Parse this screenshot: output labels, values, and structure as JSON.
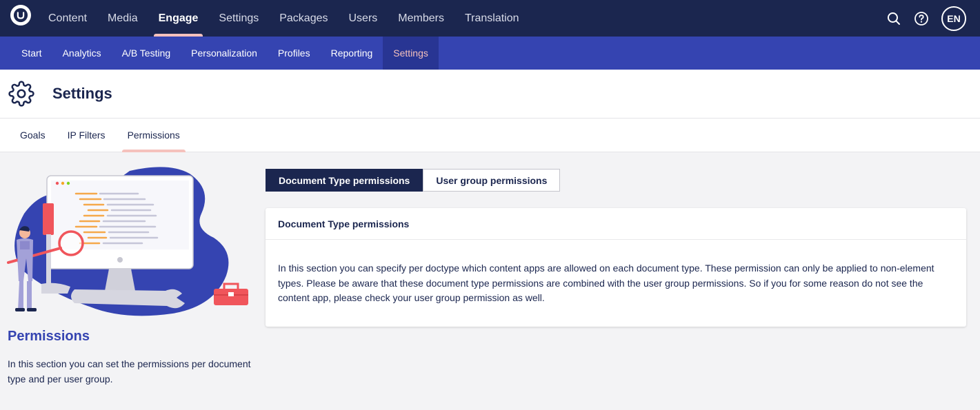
{
  "top_nav": {
    "items": [
      {
        "label": "Content",
        "active": false
      },
      {
        "label": "Media",
        "active": false
      },
      {
        "label": "Engage",
        "active": true
      },
      {
        "label": "Settings",
        "active": false
      },
      {
        "label": "Packages",
        "active": false
      },
      {
        "label": "Users",
        "active": false
      },
      {
        "label": "Members",
        "active": false
      },
      {
        "label": "Translation",
        "active": false
      }
    ],
    "avatar_initials": "EN",
    "icons": [
      "umbraco-logo-icon",
      "search-icon",
      "help-icon"
    ]
  },
  "sub_nav": {
    "items": [
      {
        "label": "Start",
        "active": false
      },
      {
        "label": "Analytics",
        "active": false
      },
      {
        "label": "A/B Testing",
        "active": false
      },
      {
        "label": "Personalization",
        "active": false
      },
      {
        "label": "Profiles",
        "active": false
      },
      {
        "label": "Reporting",
        "active": false
      },
      {
        "label": "Settings",
        "active": true
      }
    ]
  },
  "page": {
    "title": "Settings",
    "icon": "gear-icon"
  },
  "tabs": [
    {
      "label": "Goals",
      "active": false
    },
    {
      "label": "IP Filters",
      "active": false
    },
    {
      "label": "Permissions",
      "active": true
    }
  ],
  "left_panel": {
    "title": "Permissions",
    "description": "In this section you can set the permissions per document type and per user group."
  },
  "toggle": {
    "document_type_label": "Document Type permissions",
    "user_group_label": "User group permissions",
    "selected": "Document Type permissions"
  },
  "card": {
    "title": "Document Type permissions",
    "body": "In this section you can specify per doctype which content apps are allowed on each document type. These permission can only be applied to non-element types. Please be aware that these document type permissions are combined with the user group permissions. So if you for some reason do not see the content app, please check your user group permission as well."
  },
  "colors": {
    "top_bar": "#1b264f",
    "sub_bar": "#3544b1",
    "active_underline": "#f5c1bc",
    "accent_blue": "#3544b1"
  }
}
